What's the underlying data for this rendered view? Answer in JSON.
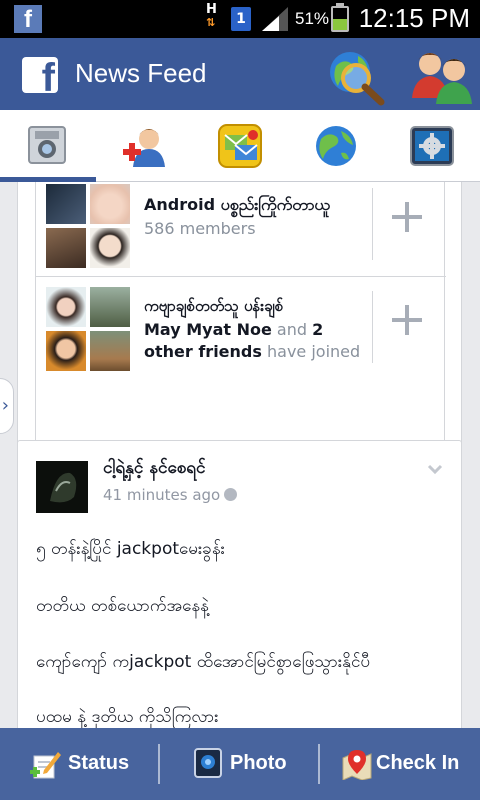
{
  "status_bar": {
    "app_letter": "f",
    "network_type": "H",
    "sim_slot": "1",
    "battery_percent": "51%",
    "battery_level": 0.51,
    "time": "12:15 PM"
  },
  "header": {
    "logo_letter": "f",
    "title": "News Feed",
    "search_icon": "globe-search-icon",
    "friends_icon": "friend-requests-icon"
  },
  "tabs": [
    {
      "icon": "camera-icon"
    },
    {
      "icon": "add-friend-icon"
    },
    {
      "icon": "messages-icon"
    },
    {
      "icon": "globe-icon"
    },
    {
      "icon": "settings-icon"
    }
  ],
  "groups": [
    {
      "name": "Android ပစ္စည်းကြိုက်တာယူ",
      "members": "586 members"
    },
    {
      "name": "ကဗျာချစ်တတ်သူ ပန်းချစ်",
      "friend1": "May Myat Noe",
      "and_text": " and ",
      "friend2": "2 other friends",
      "joined_text": " have joined"
    }
  ],
  "post": {
    "author": "ငါ့ရဲ့နှင့် နင်စေရင်",
    "time": "41 minutes ago",
    "lines": [
      "၅ တန်းနဲ့ပြိုင် jackpotမေးခွန်း",
      "တတိယ တစ်ယောက်အနေနဲ့",
      "ကျော်ကျော် ကjackpot ထိအောင်မြင်စွာဖြေသွားနိုင်ပီ",
      "ပထမ နဲ့ ဒုတိယ ကိုသိကြလား"
    ]
  },
  "bottom_bar": {
    "status_label": "Status",
    "photo_label": "Photo",
    "checkin_label": "Check In"
  },
  "colors": {
    "brand": "#3b5998",
    "background": "#e9eaed",
    "muted_text": "#89919c"
  }
}
